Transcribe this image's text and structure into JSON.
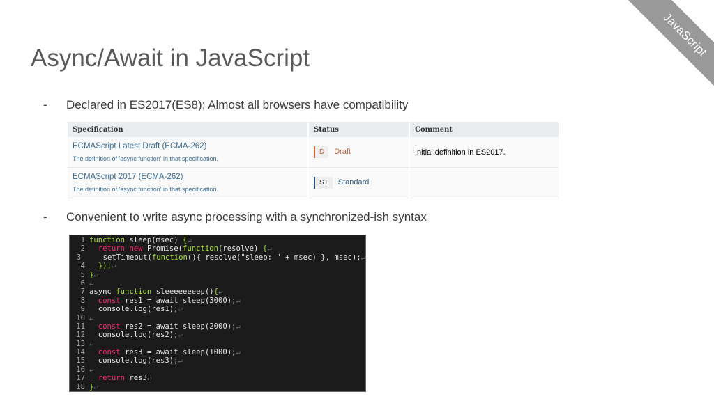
{
  "title": "Async/Await in JavaScript",
  "ribbon": "JavaScript",
  "bullets": [
    {
      "dash": "-",
      "text": "Declared in ES2017(ES8); Almost all browsers have compatibility"
    },
    {
      "dash": "-",
      "text": "Convenient to write async processing with a synchronized-ish syntax"
    }
  ],
  "table": {
    "headers": [
      "Specification",
      "Status",
      "Comment"
    ],
    "rows": [
      {
        "spec": "ECMAScript Latest Draft (ECMA-262)",
        "desc": "The definition of 'async function' in that specification.",
        "badge": "D",
        "status": "Draft",
        "comment": "Initial definition in ES2017."
      },
      {
        "spec": "ECMAScript 2017 (ECMA-262)",
        "desc": "The definition of 'async function' in that specification.",
        "badge": "ST",
        "status": "Standard",
        "comment": ""
      }
    ]
  },
  "code": [
    [
      [
        "g",
        "function"
      ],
      [
        "t",
        " sleep(msec) "
      ],
      [
        "g",
        "{"
      ]
    ],
    [
      [
        "t",
        "  "
      ],
      [
        "r",
        "return"
      ],
      [
        "t",
        " "
      ],
      [
        "r",
        "new"
      ],
      [
        "t",
        " Promise("
      ],
      [
        "g",
        "function"
      ],
      [
        "t",
        "(resolve) "
      ],
      [
        "g",
        "{"
      ]
    ],
    [
      [
        "t",
        "    setTimeout("
      ],
      [
        "g",
        "function"
      ],
      [
        "t",
        "(){ resolve(\"sleep: \" + msec) }, msec);"
      ]
    ],
    [
      [
        "t",
        "  "
      ],
      [
        "g",
        "});"
      ]
    ],
    [
      [
        "g",
        "}"
      ]
    ],
    [],
    [
      [
        "t",
        "async "
      ],
      [
        "g",
        "function"
      ],
      [
        "t",
        " sleeeeeeeep()"
      ],
      [
        "g",
        "{"
      ]
    ],
    [
      [
        "t",
        "  "
      ],
      [
        "r",
        "const"
      ],
      [
        "t",
        " res1 = await sleep(3000);"
      ]
    ],
    [
      [
        "t",
        "  console.log(res1);"
      ]
    ],
    [],
    [
      [
        "t",
        "  "
      ],
      [
        "r",
        "const"
      ],
      [
        "t",
        " res2 = await sleep(2000);"
      ]
    ],
    [
      [
        "t",
        "  console.log(res2);"
      ]
    ],
    [],
    [
      [
        "t",
        "  "
      ],
      [
        "r",
        "const"
      ],
      [
        "t",
        " res3 = await sleep(1000);"
      ]
    ],
    [
      [
        "t",
        "  console.log(res3);"
      ]
    ],
    [],
    [
      [
        "t",
        "  "
      ],
      [
        "r",
        "return"
      ],
      [
        "t",
        " res3"
      ]
    ],
    [
      [
        "g",
        "}"
      ]
    ]
  ],
  "eol": "↵"
}
